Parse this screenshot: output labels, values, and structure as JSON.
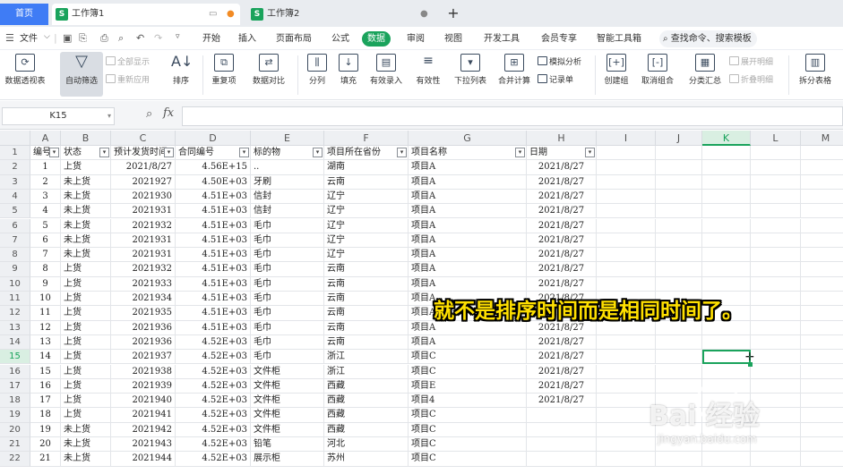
{
  "tabs": {
    "home": "首页",
    "docs": [
      {
        "label": "工作簿1",
        "active": true
      },
      {
        "label": "工作簿2",
        "active": false
      }
    ],
    "new_tab": "+"
  },
  "menu": {
    "file": "文件",
    "items": [
      "开始",
      "插入",
      "页面布局",
      "公式",
      "数据",
      "审阅",
      "视图",
      "开发工具",
      "会员专享",
      "智能工具箱"
    ],
    "active": "数据",
    "search": "查找命令、搜索模板"
  },
  "ribbon": {
    "pivot": "数据透视表",
    "autofilter": "自动筛选",
    "show_all": "全部显示",
    "reapply": "重新应用",
    "sort": "排序",
    "dup": "重复项",
    "compare": "数据对比",
    "split": "分列",
    "fill": "填充",
    "input": "有效录入",
    "validity": "有效性",
    "dropdown": "下拉列表",
    "merge_calc": "合并计算",
    "sim_analysis": "模拟分析",
    "records": "记录单",
    "group": "创建组",
    "ungroup": "取消组合",
    "subtotal": "分类汇总",
    "expand": "展开明细",
    "collapse": "折叠明细",
    "split_sheet": "拆分表格"
  },
  "formula_bar": {
    "name_box": "K15",
    "fx": "fx",
    "value": ""
  },
  "grid": {
    "columns": [
      "A",
      "B",
      "C",
      "D",
      "E",
      "F",
      "G",
      "H",
      "I",
      "J",
      "K",
      "L",
      "M"
    ],
    "selected_col": "K",
    "selected_row": 15,
    "header_row": [
      "编号",
      "状态",
      "预计发货时间",
      "合同编号",
      "标的物",
      "项目所在省份",
      "项目名称",
      "日期"
    ],
    "rows": [
      [
        "1",
        "上货",
        "2021/8/27",
        "4.56E+15",
        "..",
        "湖南",
        "项目A",
        "2021/8/27"
      ],
      [
        "2",
        "未上货",
        "2021927",
        "4.50E+03",
        "牙刷",
        "云南",
        "项目A",
        "2021/8/27"
      ],
      [
        "3",
        "未上货",
        "2021930",
        "4.51E+03",
        "信封",
        "辽宁",
        "项目A",
        "2021/8/27"
      ],
      [
        "4",
        "未上货",
        "2021931",
        "4.51E+03",
        "信封",
        "辽宁",
        "项目A",
        "2021/8/27"
      ],
      [
        "5",
        "未上货",
        "2021932",
        "4.51E+03",
        "毛巾",
        "辽宁",
        "项目A",
        "2021/8/27"
      ],
      [
        "6",
        "未上货",
        "2021931",
        "4.51E+03",
        "毛巾",
        "辽宁",
        "项目A",
        "2021/8/27"
      ],
      [
        "7",
        "未上货",
        "2021931",
        "4.51E+03",
        "毛巾",
        "辽宁",
        "项目A",
        "2021/8/27"
      ],
      [
        "8",
        "上货",
        "2021932",
        "4.51E+03",
        "毛巾",
        "云南",
        "项目A",
        "2021/8/27"
      ],
      [
        "9",
        "上货",
        "2021933",
        "4.51E+03",
        "毛巾",
        "云南",
        "项目A",
        "2021/8/27"
      ],
      [
        "10",
        "上货",
        "2021934",
        "4.51E+03",
        "毛巾",
        "云南",
        "项目A",
        "2021/8/27"
      ],
      [
        "11",
        "上货",
        "2021935",
        "4.51E+03",
        "毛巾",
        "云南",
        "项目A",
        "2021/8/27"
      ],
      [
        "12",
        "上货",
        "2021936",
        "4.51E+03",
        "毛巾",
        "云南",
        "项目A",
        "2021/8/27"
      ],
      [
        "13",
        "上货",
        "2021936",
        "4.52E+03",
        "毛巾",
        "云南",
        "项目A",
        "2021/8/27"
      ],
      [
        "14",
        "上货",
        "2021937",
        "4.52E+03",
        "毛巾",
        "浙江",
        "项目C",
        "2021/8/27"
      ],
      [
        "15",
        "上货",
        "2021938",
        "4.52E+03",
        "文件柜",
        "浙江",
        "项目C",
        "2021/8/27"
      ],
      [
        "16",
        "上货",
        "2021939",
        "4.52E+03",
        "文件柜",
        "西藏",
        "项目E",
        "2021/8/27"
      ],
      [
        "17",
        "上货",
        "2021940",
        "4.52E+03",
        "文件柜",
        "西藏",
        "项目4",
        "2021/8/27"
      ],
      [
        "18",
        "上货",
        "2021941",
        "4.52E+03",
        "文件柜",
        "西藏",
        "项目C",
        ""
      ],
      [
        "19",
        "未上货",
        "2021942",
        "4.52E+03",
        "文件柜",
        "西藏",
        "项目C",
        ""
      ],
      [
        "20",
        "未上货",
        "2021943",
        "4.52E+03",
        "铅笔",
        "河北",
        "项目C",
        ""
      ],
      [
        "21",
        "未上货",
        "2021944",
        "4.52E+03",
        "展示柜",
        "苏州",
        "项目C",
        ""
      ]
    ]
  },
  "overlay_caption": "就不是排序时间而是相同时间了。",
  "watermark": {
    "logo": "Bai 经验",
    "sub": "jingyan.baidu.com"
  },
  "colors": {
    "accent": "#1aa35c",
    "home_tab": "#3f7cf5",
    "caption": "#ffe000"
  }
}
